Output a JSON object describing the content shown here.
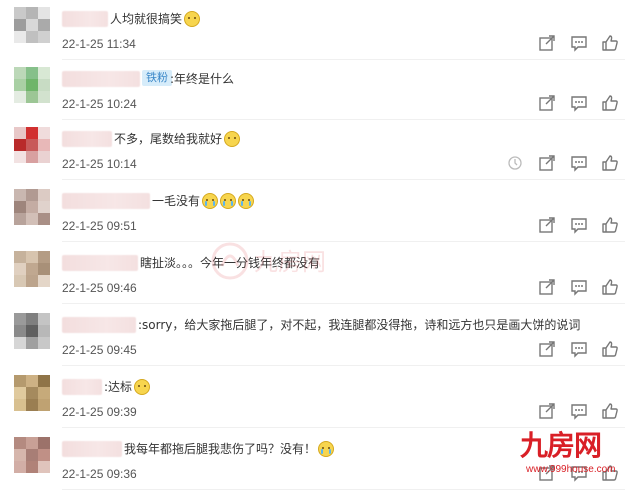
{
  "comments": [
    {
      "text": "人均就很搞笑",
      "emoji": [
        "smirk"
      ],
      "time": "22-1-25 11:34"
    },
    {
      "badge": "铁粉",
      "text": ":年终是什么",
      "emoji": [],
      "time": "22-1-25 10:24"
    },
    {
      "text": "不多，尾数给我就好",
      "emoji": [
        "sweat"
      ],
      "time": "22-1-25 10:14"
    },
    {
      "text": "一毛没有",
      "emoji": [
        "cry",
        "cry",
        "cry"
      ],
      "time": "22-1-25 09:51"
    },
    {
      "text": "瞎扯淡。。。今年一分钱年终都没有",
      "emoji": [],
      "time": "22-1-25 09:46"
    },
    {
      "text": ":sorry，给大家拖后腿了，对不起，我连腿都没得拖，诗和远方也只是画大饼的说词",
      "emoji": [],
      "time": "22-1-25 09:45"
    },
    {
      "text": ":达标",
      "emoji": [
        "smirk"
      ],
      "time": "22-1-25 09:39"
    },
    {
      "text": "我每年都拖后腿我悲伤了吗？没有！",
      "emoji": [
        "cry"
      ],
      "time": "22-1-25 09:36"
    }
  ],
  "icons": {
    "repost": "share-icon",
    "comment": "comment-icon",
    "like": "like-icon",
    "refresh": "timer-icon"
  },
  "watermark": {
    "main": "九房网",
    "url": "www.999house.com"
  },
  "colors": {
    "brand": "#d91f26",
    "badge_bg": "#d6ecfa",
    "badge_text": "#3a87c8"
  }
}
